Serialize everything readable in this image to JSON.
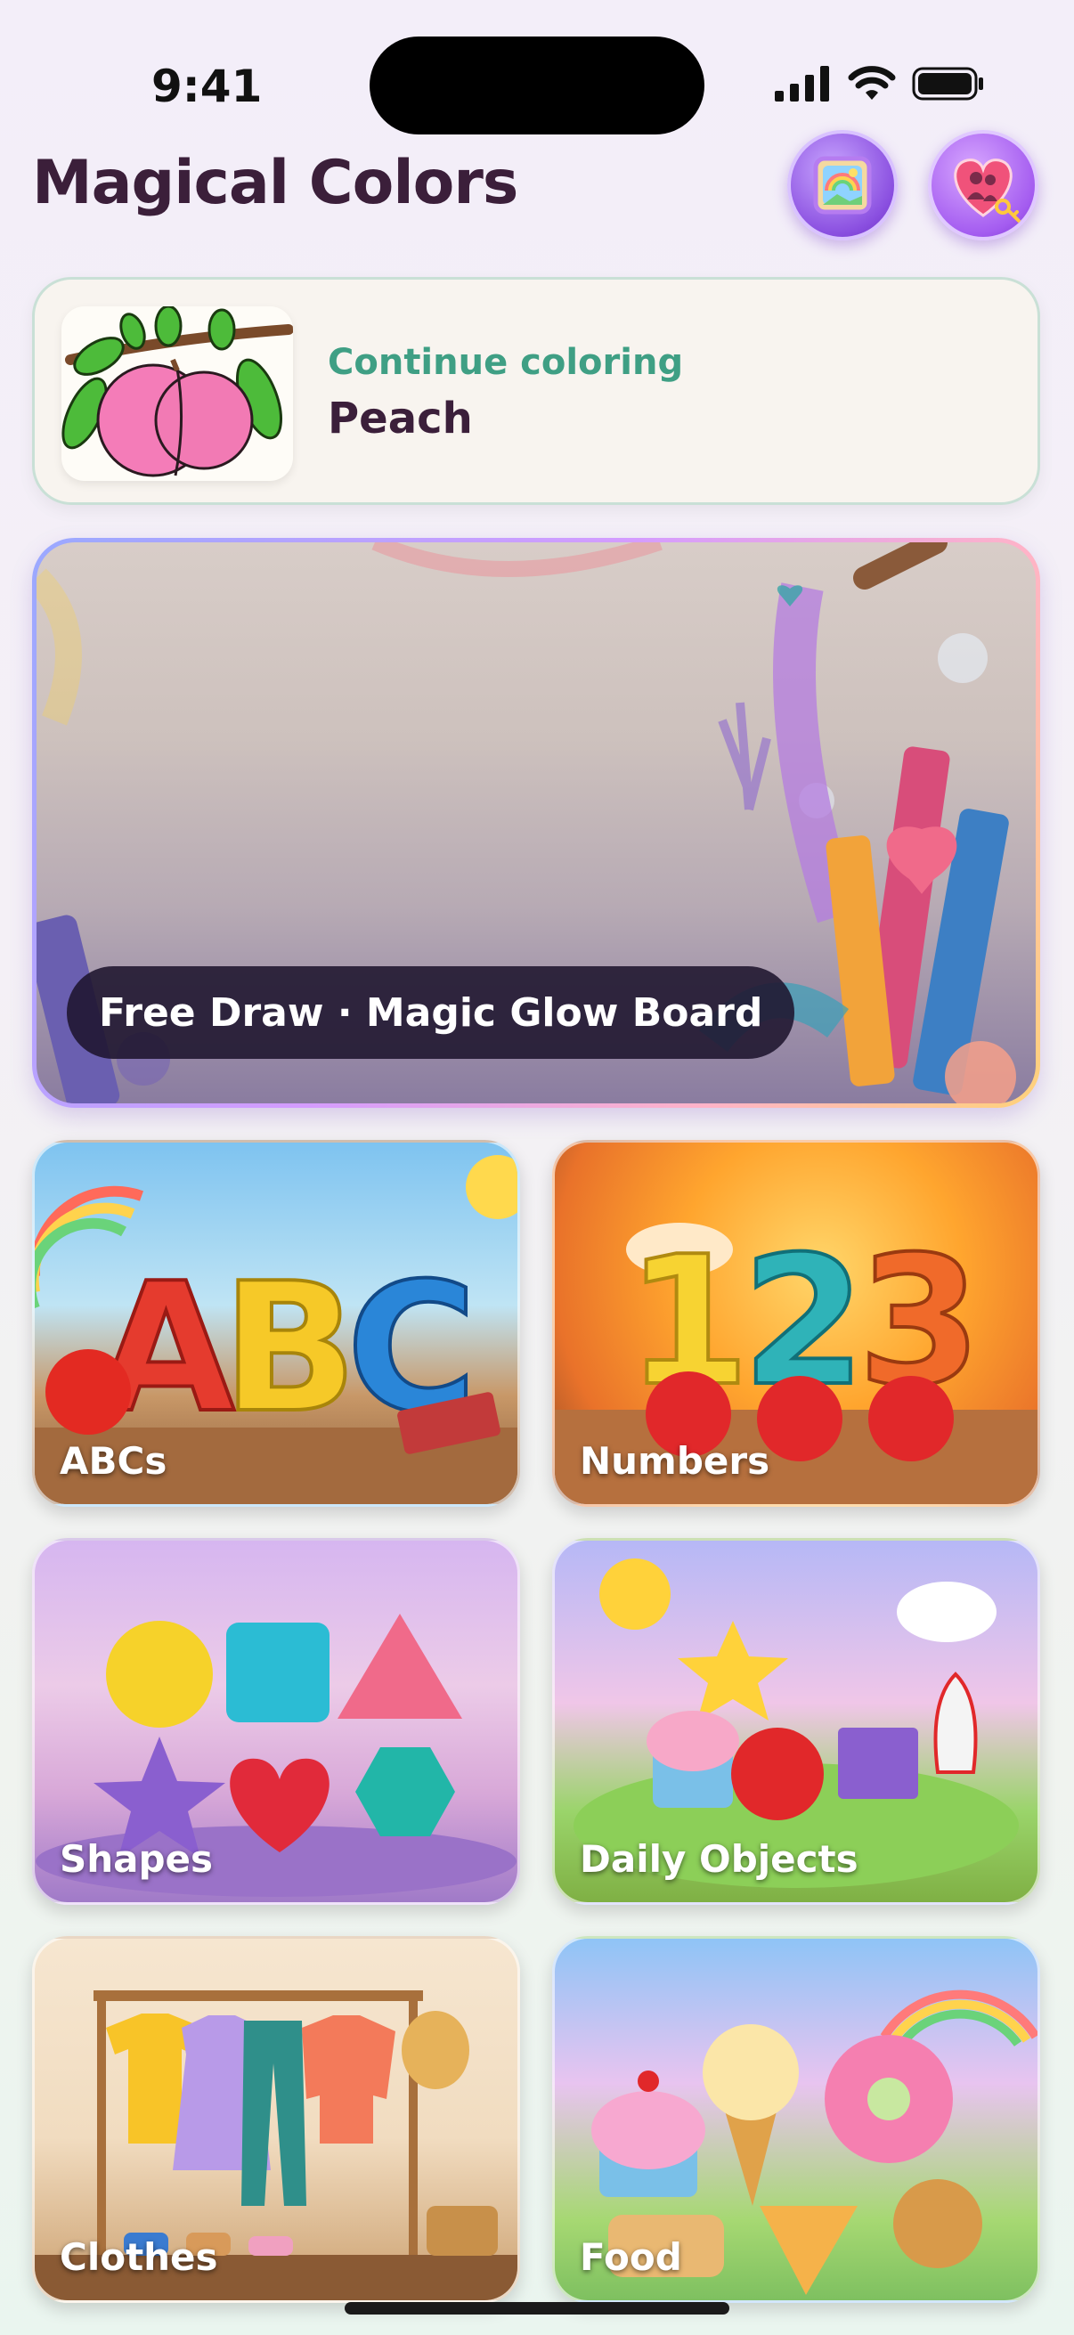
{
  "status_bar": {
    "time": "9:41"
  },
  "header": {
    "title": "Magical Colors"
  },
  "continue_card": {
    "label": "Continue coloring",
    "item_name": "Peach"
  },
  "banner": {
    "label": "Free Draw · Magic Glow Board"
  },
  "categories": [
    {
      "label": "ABCs"
    },
    {
      "label": "Numbers"
    },
    {
      "label": "Shapes"
    },
    {
      "label": "Daily Objects"
    },
    {
      "label": "Clothes"
    },
    {
      "label": "Food"
    }
  ],
  "colors": {
    "accent_green": "#3f9f84",
    "title_dark": "#3b1f3a",
    "pill_bg": "#1e142d"
  }
}
